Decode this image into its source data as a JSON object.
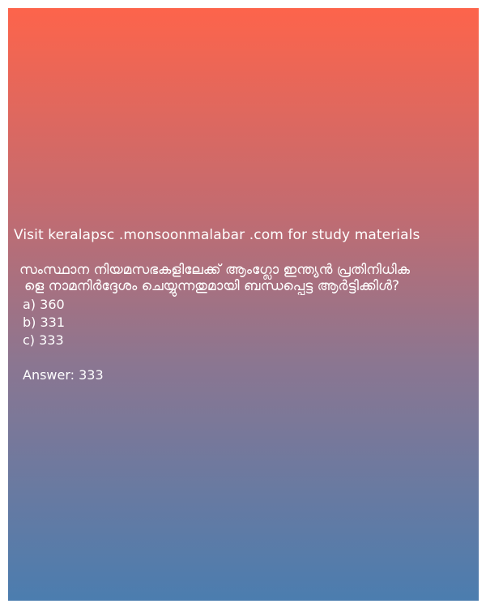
{
  "colors": {
    "gradient_top": "#fd644b",
    "gradient_bottom": "#4b7daf",
    "text": "#ffffff"
  },
  "card": {
    "visit_text": "Visit keralapsc .monsoonmalabar .com for study materials",
    "question_line1": "സംസ്ഥാന നിയമസഭകളിലേക്ക് ആംഗ്ലോ ഇന്ത്യൻ പ്രതിനിധിക",
    "question_line2": "ളെ നാമനിർദ്ദേശം ചെയ്യുന്നതുമായി ബന്ധപ്പെട്ട ആർട്ടിക്കിൾ?",
    "options": [
      {
        "label": "a) 360"
      },
      {
        "label": "b) 331"
      },
      {
        "label": "c) 333"
      }
    ],
    "answer": "Answer: 333"
  }
}
